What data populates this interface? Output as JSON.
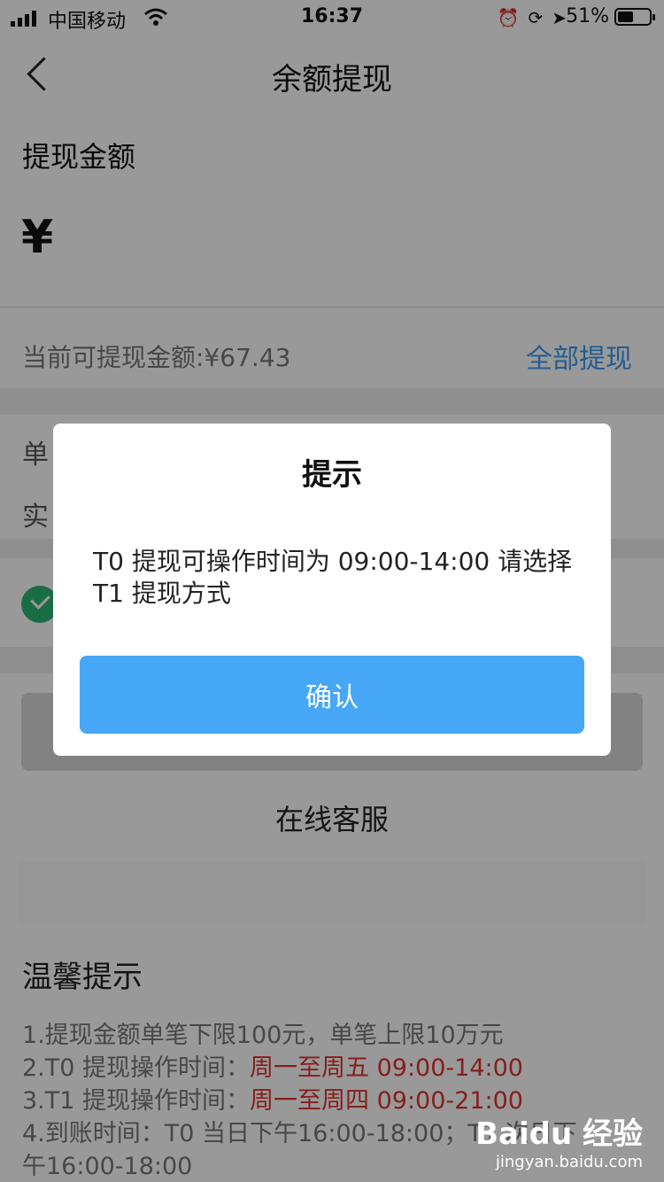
{
  "status_bar": {
    "carrier": "中国移动",
    "time": "16:37",
    "battery": "51%",
    "battery_level": 0.51
  },
  "nav": {
    "title": "余额提现"
  },
  "amount": {
    "label": "提现金额",
    "currency_symbol": "¥",
    "available_text": "当前可提现金额:¥67.43",
    "withdraw_all_label": "全部提现"
  },
  "rows": {
    "row1_partial": "单",
    "row2_partial": "实"
  },
  "online_service_label": "在线客服",
  "tips": {
    "title": "温馨提示",
    "line1": "1.提现金额单笔下限100元，单笔上限10万元",
    "line2_prefix": "2.T0 提现操作时间：",
    "line2_highlight": "周一至周五 09:00-14:00",
    "line3_prefix": "3.T1 提现操作时间：",
    "line3_highlight": "周一至周四 09:00-21:00",
    "line4": "4.到账时间：T0 当日下午16:00-18:00；T1 次日下",
    "line5": "午16:00-18:00"
  },
  "dialog": {
    "title": "提示",
    "message": "T0 提现可操作时间为 09:00-14:00 请选择 T1 提现方式",
    "confirm_label": "确认"
  },
  "watermark": {
    "logo": "Baidu 经验",
    "url": "jingyan.baidu.com"
  },
  "colors": {
    "accent_blue": "#46a7f6",
    "link_blue": "#3a9bf0",
    "highlight_red": "#e0332f",
    "check_green": "#2bb673"
  }
}
